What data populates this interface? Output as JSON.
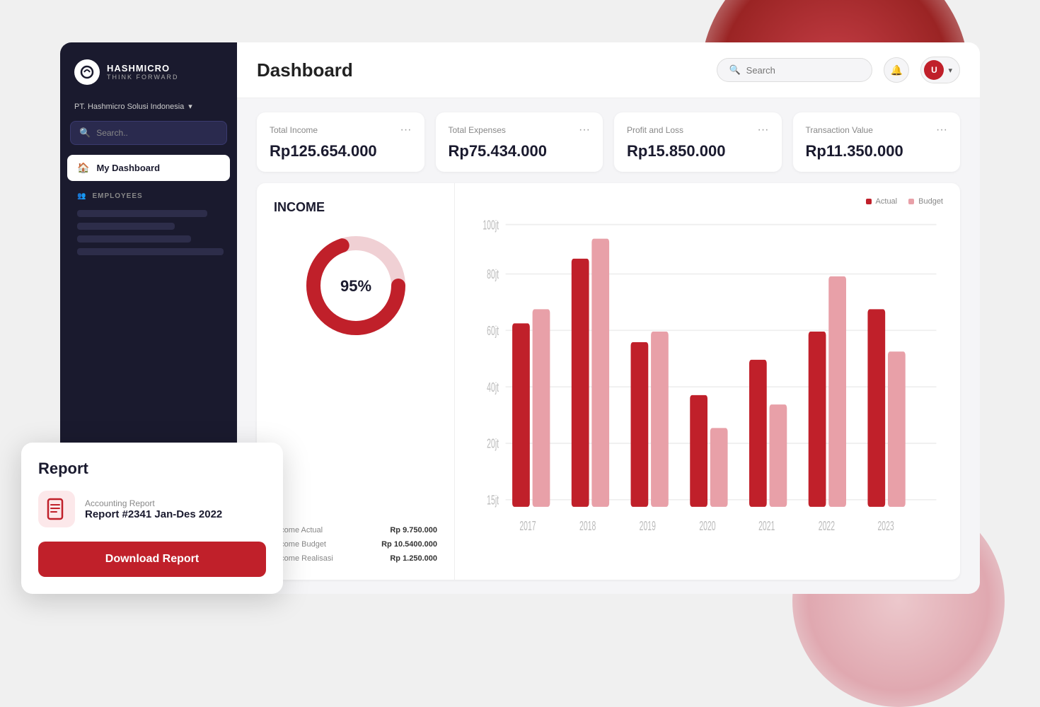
{
  "background": {
    "circle_top": "top-right decorative",
    "circle_bottom": "bottom-right decorative"
  },
  "sidebar": {
    "logo": {
      "icon_text": "#",
      "brand_name": "HASHMICRO",
      "brand_tagline": "THINK FORWARD"
    },
    "company_name": "PT. Hashmicro Solusi Indonesia",
    "search_placeholder": "Search..",
    "nav_active": "My Dashboard",
    "section_label": "EMPLOYEES"
  },
  "header": {
    "page_title": "Dashboard",
    "search_placeholder": "Search",
    "notification_icon": "bell",
    "user_icon": "user-avatar"
  },
  "stats": [
    {
      "label": "Total Income",
      "value": "Rp125.654.000"
    },
    {
      "label": "Total Expenses",
      "value": "Rp75.434.000"
    },
    {
      "label": "Profit and Loss",
      "value": "Rp15.850.000"
    },
    {
      "label": "Transaction Value",
      "value": "Rp11.350.000"
    }
  ],
  "income": {
    "title": "INCOME",
    "donut_percent": "95%",
    "donut_actual_pct": 95,
    "stats": [
      {
        "label": "Income Actual",
        "value": "Rp 9.750.000"
      },
      {
        "label": "Income Budget",
        "value": "Rp 10.5400.000"
      },
      {
        "label": "Income Realisasi",
        "value": "Rp 1.250.000"
      }
    ],
    "legend": {
      "actual": "Actual",
      "budget": "Budget"
    },
    "chart": {
      "y_labels": [
        "100jt",
        "80jt",
        "60jt",
        "40jt",
        "20jt",
        "15jt"
      ],
      "years": [
        "2017",
        "2018",
        "2019",
        "2020",
        "2021",
        "2022",
        "2023"
      ],
      "actual_heights": [
        65,
        88,
        58,
        38,
        52,
        62,
        68
      ],
      "budget_heights": [
        70,
        95,
        62,
        28,
        36,
        80,
        55
      ]
    }
  },
  "report": {
    "title": "Report",
    "type": "Accounting Report",
    "name": "Report #2341 Jan-Des 2022",
    "download_label": "Download Report"
  }
}
